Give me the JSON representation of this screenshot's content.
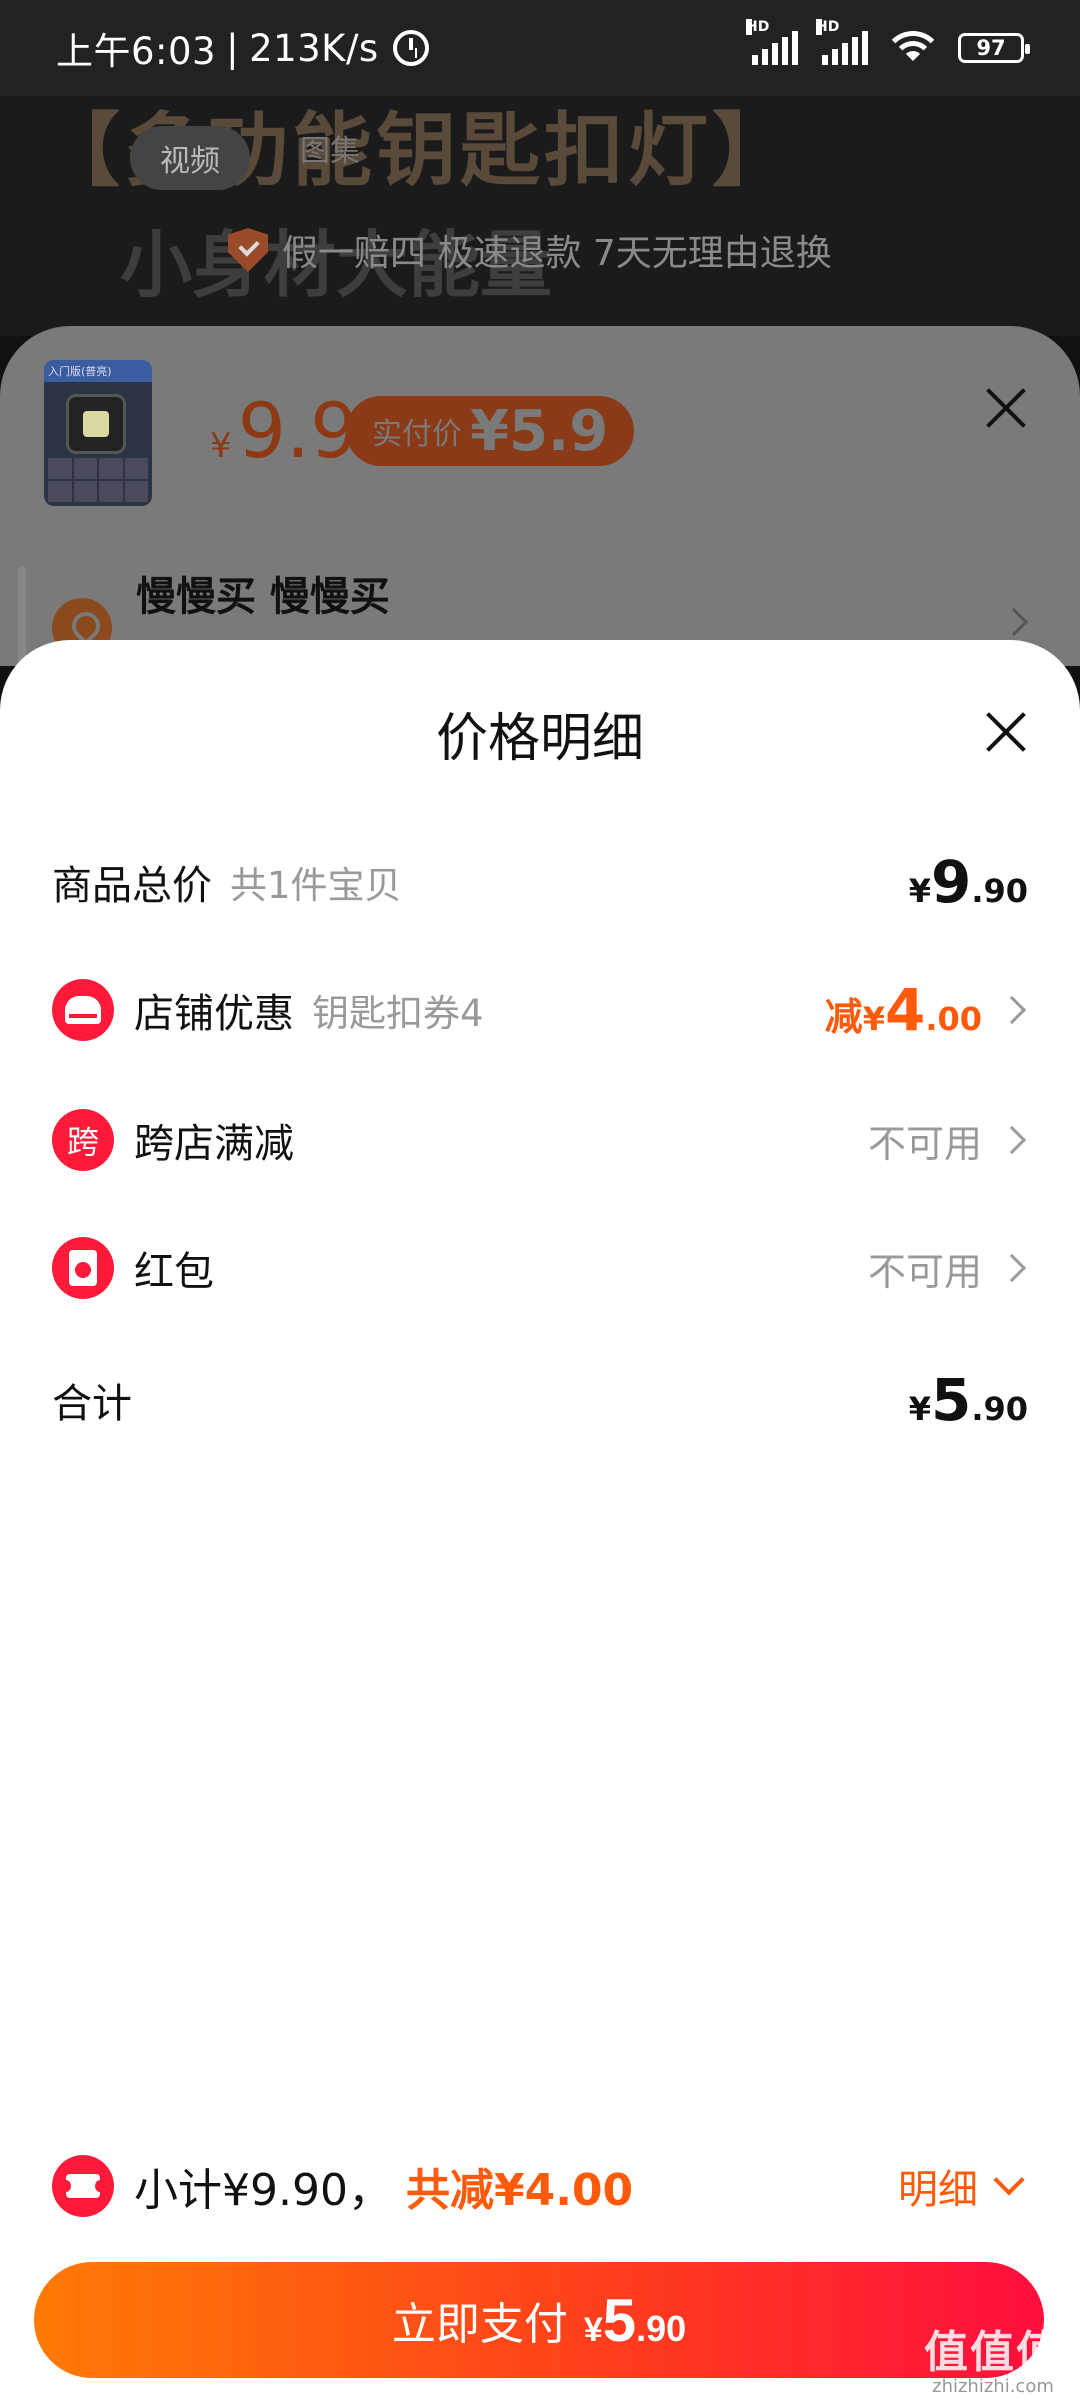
{
  "status_bar": {
    "time": "上午6:03",
    "speed": "213K/s",
    "battery": "97",
    "hd": "HD"
  },
  "background": {
    "heading": "【多功能钥匙扣灯】",
    "tabs": [
      "视频",
      "图集"
    ],
    "subtitle": "小身材大能量",
    "guarantee": "假一赔四 极速退款 7天无理由退换"
  },
  "sku": {
    "thumb_label": "入门版(普亮)",
    "price_yen": "¥",
    "price": "9.9",
    "actual_label": "实付价",
    "actual_price": "¥5.9",
    "address": "慢慢买 慢慢买"
  },
  "detail": {
    "title": "价格明细",
    "rows": [
      {
        "label": "商品总价",
        "sub": "共1件宝贝",
        "yen": "¥",
        "int": "9",
        "dec": ".90"
      },
      {
        "label": "店铺优惠",
        "sub": "钥匙扣券4",
        "pre": "减",
        "yen": "¥",
        "int": "4",
        "dec": ".00",
        "color": "#ff5a0a"
      },
      {
        "label": "跨店满减",
        "icon_text": "跨",
        "value": "不可用"
      },
      {
        "label": "红包",
        "value": "不可用"
      },
      {
        "label": "合计",
        "yen": "¥",
        "int": "5",
        "dec": ".90"
      }
    ]
  },
  "summary": {
    "subtotal": "小计¥9.90，",
    "reduce": "共减¥4.00",
    "detail_label": "明细"
  },
  "pay": {
    "label": "立即支付",
    "yen": "¥",
    "int": "5",
    "dec": ".90"
  },
  "watermark": {
    "main": "值值值",
    "sub": "zhizhizhi.com"
  },
  "colors": {
    "accent_orange": "#ff5a0a",
    "icon_red": "#ff1a3a",
    "gradient_start": "#ff7a05",
    "gradient_end": "#ff0e3e"
  }
}
